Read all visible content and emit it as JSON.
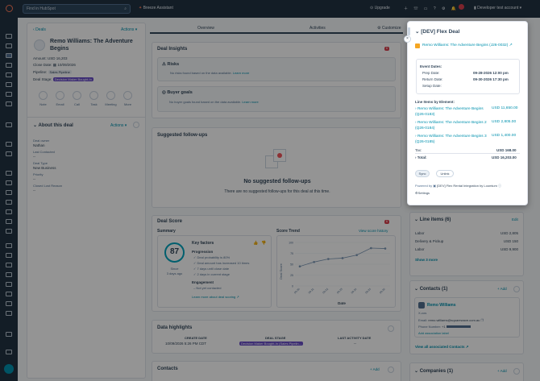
{
  "topbar": {
    "search_placeholder": "Find in HubSpot",
    "breeze": "Breeze Assistant",
    "upgrade": "Upgrade",
    "account": "Developer test account"
  },
  "left": {
    "back_link": "Deals",
    "actions": "Actions",
    "deal_name": "Remo Williams: The Adventure Begins",
    "amount": "Amount: USD 16,203",
    "close_date_label": "Close Date:",
    "close_date": "10/09/2026",
    "pipeline_label": "Pipeline:",
    "pipeline": "Sales Pipeline",
    "stage_label": "Deal Stage:",
    "stage": "Decision Maker Bought-In",
    "quick_actions": [
      "Note",
      "Email",
      "Call",
      "Task",
      "Meeting",
      "More"
    ],
    "about_title": "About this deal",
    "about_actions": "Actions",
    "fields": [
      {
        "label": "Deal owner",
        "value": "Nathan"
      },
      {
        "label": "Last Contacted",
        "value": "--"
      },
      {
        "label": "Deal Type",
        "value": "New Business"
      },
      {
        "label": "Priority",
        "value": "--"
      },
      {
        "label": "Closed Lost Reason",
        "value": "--"
      }
    ]
  },
  "tabs": [
    "Overview",
    "Activities",
    "Customize"
  ],
  "insights": {
    "title": "Deal Insights",
    "badge": "6",
    "risks_title": "Risks",
    "risks_text": "No risks found based on the data available.",
    "learn_more": "Learn more",
    "goals_title": "Buyer goals",
    "goals_text": "No buyer goals found based on the data available."
  },
  "followups": {
    "title": "Suggested follow-ups",
    "empty_title": "No suggested follow-ups",
    "empty_text": "There are no suggested follow-ups for this deal at this time."
  },
  "score": {
    "title": "Deal Score",
    "badge": "6",
    "summary": "Summary",
    "value": "87",
    "since_label": "Since",
    "since": "3 days ago",
    "key_factors": "Key factors",
    "progression": "Progression",
    "factors": [
      "Deal probability is 80%",
      "Deal amount has increased 10 times",
      "7 days until close date",
      "2 days in current stage"
    ],
    "engagement": "Engagement",
    "engagement_item": "Not yet contacted",
    "learn": "Learn more about deal scoring",
    "trend_title": "Score Trend",
    "view_history": "View score history",
    "ylabel": "Deal Score",
    "xlabel": "Date"
  },
  "chart_data": {
    "type": "line",
    "title": "Score Trend",
    "xlabel": "Date",
    "ylabel": "Deal Score",
    "ylim": [
      0,
      100
    ],
    "yticks": [
      0,
      25,
      50,
      75,
      100
    ],
    "x": [
      "09-20",
      "09-21",
      "09-22",
      "09-23",
      "09-24",
      "09-25",
      "09-26"
    ],
    "values": [
      45,
      55,
      62,
      64,
      71,
      87,
      86
    ],
    "color": "#7c98b6"
  },
  "highlights": {
    "title": "Data highlights",
    "create_date_label": "CREATE DATE",
    "create_date": "10/09/2026 5:26 PM CDT",
    "stage_label": "DEAL STAGE",
    "stage": "Decision Maker Bought-In (Sales Pipelin...",
    "last_activity_label": "LAST ACTIVITY DATE",
    "last_activity": "--"
  },
  "contacts_mid": {
    "title": "Contacts",
    "add": "Add"
  },
  "panel": {
    "title": "[DEV] Flex Deal",
    "deal_link": "Remo Williams: The Adventure Begins (J26-0032)",
    "event_dates": "Event Dates:",
    "prep_label": "Prep Date:",
    "prep": "09-28-2026 12:00 pm",
    "return_label": "Return Date:",
    "return": "09-30-2026 17:30 pm",
    "setup_label": "Setup Date:",
    "setup": "",
    "line_items_title": "Line Items by Element:",
    "items": [
      {
        "name": "Remo Williams: The Adventure Begins (Q26-0183)",
        "price": "USD 11,650.00"
      },
      {
        "name": "Remo Williams: The Adventure Begins 2 (Q26-0184)",
        "price": "USD 2,805.00"
      },
      {
        "name": "Remo Williams: The Adventure Begins 3 (Q26-0185)",
        "price": "USD 1,400.00"
      }
    ],
    "tax_label": "Tax:",
    "tax": "USD 168.00",
    "total_label": "Total:",
    "total": "USD 16,203.00",
    "sync": "Sync",
    "unlink": "Unlink",
    "powered": "Powered by",
    "powered_rest": "[DEV] Flex Rental Integration by Loomium",
    "settings": "Settings"
  },
  "right": {
    "line_items_title": "Line items (6)",
    "edit": "Edit",
    "rows": [
      {
        "name": "Labor",
        "value": "USD 2,805"
      },
      {
        "name": "Delivery & Pickup",
        "value": "USD 150"
      },
      {
        "name": "Labor",
        "value": "USD 9,900"
      }
    ],
    "show_more": "Show 3 more",
    "contacts_title": "Contacts (1)",
    "add": "Add",
    "contact_name": "Remo Williams",
    "contact_company": "X-cos",
    "email_label": "Email:",
    "email": "remo.williams@squarewave.com.au",
    "phone_label": "Phone Number:",
    "phone": "+1",
    "assoc": "Add association label",
    "view_all": "View all associated Contacts",
    "companies_title": "Companies (1)"
  }
}
